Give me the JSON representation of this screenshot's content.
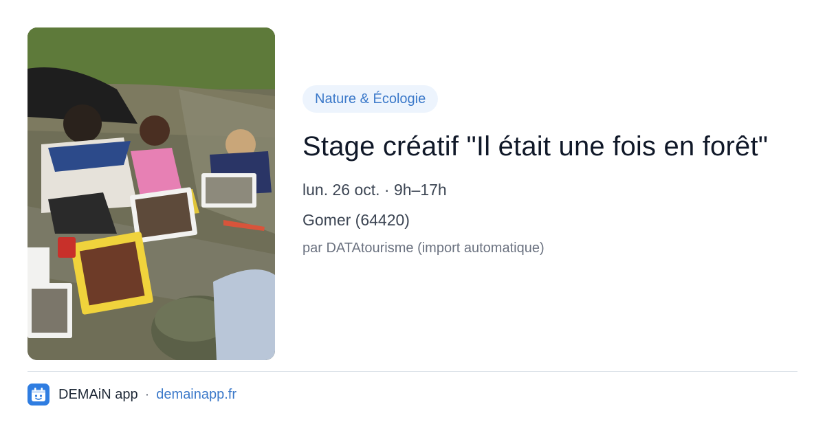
{
  "event": {
    "category": "Nature & Écologie",
    "title": "Stage créatif \"Il était une fois en forêt\"",
    "date": "lun. 26 oct. · 9h–17h",
    "location": "Gomer (64420)",
    "source": "par DATAtourisme (import automatique)"
  },
  "footer": {
    "app_name": "DEMAiN app",
    "separator": "·",
    "domain": "demainapp.fr",
    "logo_icon": "demain-app-icon"
  },
  "colors": {
    "accent": "#3a78c9",
    "tag_background": "#edf4fd",
    "logo_background": "#2f7de1"
  }
}
